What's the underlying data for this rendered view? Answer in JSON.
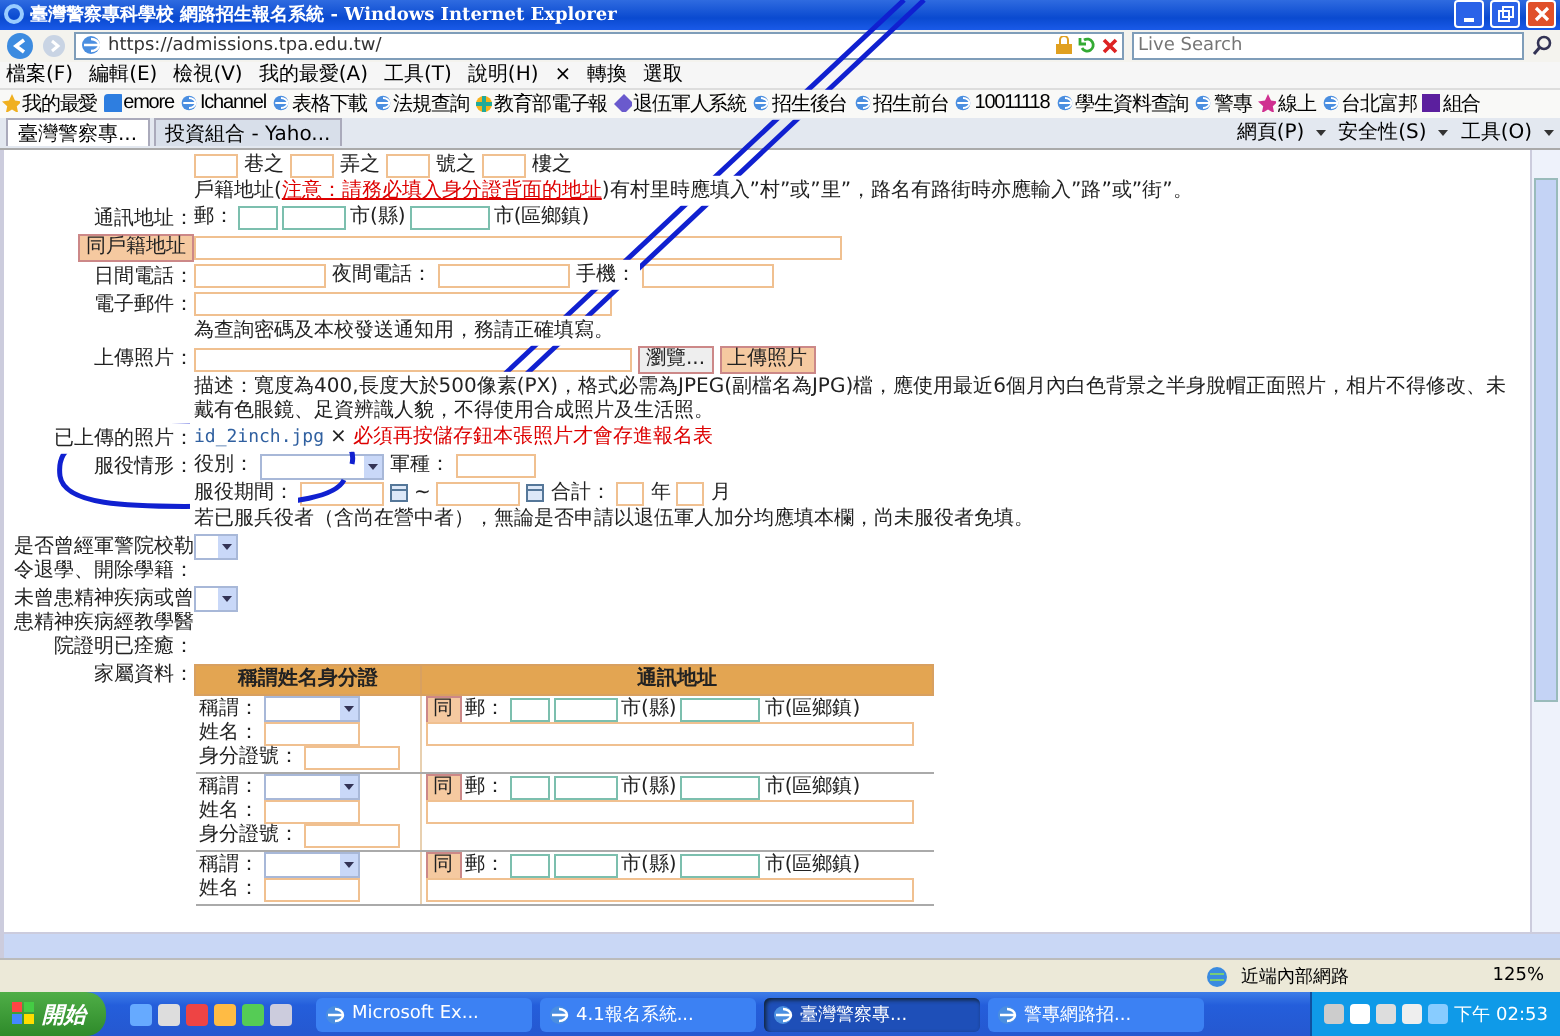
{
  "window": {
    "title": "臺灣警察專科學校 網路招生報名系統 - Windows Internet Explorer"
  },
  "address_bar": {
    "url": "https://admissions.tpa.edu.tw/",
    "search_placeholder": "Live Search"
  },
  "menu": [
    "檔案(F)",
    "編輯(E)",
    "檢視(V)",
    "我的最愛(A)",
    "工具(T)",
    "說明(H)"
  ],
  "menu_tools": {
    "close": "×",
    "items": [
      "轉換",
      "選取"
    ]
  },
  "favorites": {
    "label": "我的最愛",
    "links": [
      {
        "label": "emore",
        "kind": "square"
      },
      {
        "label": "Ichannel",
        "kind": "ie"
      },
      {
        "label": "表格下載",
        "kind": "ie"
      },
      {
        "label": "法規查詢",
        "kind": "ie"
      },
      {
        "label": "教育部電子報",
        "kind": "wheel"
      },
      {
        "label": "退伍軍人系統",
        "kind": "diamond"
      },
      {
        "label": "招生後台",
        "kind": "ie"
      },
      {
        "label": "招生前台",
        "kind": "ie"
      },
      {
        "label": "10011118",
        "kind": "ie"
      },
      {
        "label": "學生資料查詢",
        "kind": "ie"
      },
      {
        "label": "警專",
        "kind": "ie"
      },
      {
        "label": "線上",
        "kind": "star"
      },
      {
        "label": "台北富邦",
        "kind": "ie"
      },
      {
        "label": "組合",
        "kind": "yahoo"
      }
    ]
  },
  "tabs": [
    {
      "label": "臺灣警察專...",
      "selected": true
    },
    {
      "label": "投資組合 - Yaho...",
      "selected": false
    }
  ],
  "command_bar": [
    "網頁(P)",
    "安全性(S)",
    "工具(O)"
  ],
  "form": {
    "address_parts": [
      "巷之",
      "弄之",
      "號之",
      "樓之"
    ],
    "registered_address_note": {
      "prefix": "戶籍地址(",
      "warning": "注意：請務必填入身分證背面的地址",
      "suffix": ")有村里時應填入”村”或”里”，路名有路街時亦應輸入”路”或”街”。"
    },
    "mailing_address": {
      "label": "通訊地址：",
      "zip_label": "郵：",
      "county_suffix": "市(縣)",
      "district_suffix": "市(區鄉鎮)",
      "copy_button": "同戶籍地址"
    },
    "phones": [
      {
        "label": "日間電話："
      },
      {
        "label": "夜間電話："
      },
      {
        "label": "手機："
      }
    ],
    "email": {
      "label": "電子郵件：",
      "note": "為查詢密碼及本校發送通知用，務請正確填寫。"
    },
    "photo": {
      "label": "上傳照片：",
      "browse_button": "瀏覽...",
      "upload_button": "上傳照片",
      "description": "描述：寬度為400,長度大於500像素(PX)，格式必需為JPEG(副檔名為JPG)檔，應使用最近6個月內白色背景之半身脫帽正面照片，相片不得修改、未戴有色眼鏡、足資辨識人貌，不得使用合成照片及生活照。",
      "uploaded_label": "已上傳的照片：",
      "uploaded_file": "id_2inch.jpg",
      "remove": "×",
      "uploaded_warning": "必須再按儲存鈕本張照片才會存進報名表"
    },
    "military": {
      "label": "服役情形：",
      "type_label": "役別：",
      "branch_label": "軍種：",
      "period_label": "服役期間：",
      "range_sep": "~",
      "total_label": "合計：",
      "year_unit": "年",
      "month_unit": "月",
      "note": "若已服兵役者（含尚在營中者），無論是否申請以退伍軍人加分均應填本欄，尚未服役者免填。"
    },
    "questions": [
      {
        "label": "是否曾經軍警院校勒令退學、開除學籍："
      },
      {
        "label": "未曾患精神疾病或曾患精神疾病經教學醫院證明已痊癒："
      }
    ],
    "family": {
      "label": "家屬資料：",
      "columns": [
        "稱謂姓名身分證",
        "通訊地址"
      ],
      "rows": [
        {
          "title_label": "稱謂：",
          "name_label": "姓名：",
          "id_label": "身分證號：",
          "copy_button": "同",
          "zip_label": "郵：",
          "county_suffix": "市(縣)",
          "district_suffix": "市(區鄉鎮)"
        },
        {
          "title_label": "稱謂：",
          "name_label": "姓名：",
          "id_label": "身分證號：",
          "copy_button": "同",
          "zip_label": "郵：",
          "county_suffix": "市(縣)",
          "district_suffix": "市(區鄉鎮)"
        },
        {
          "title_label": "稱謂：",
          "name_label": "姓名：",
          "copy_button": "同",
          "zip_label": "郵：",
          "county_suffix": "市(縣)",
          "district_suffix": "市(區鄉鎮)"
        }
      ]
    }
  },
  "status_bar": {
    "zone": "近端內部網路",
    "zoom": "125%"
  },
  "taskbar": {
    "start": "開始",
    "tasks": [
      {
        "label": "Microsoft Ex...",
        "selected": false
      },
      {
        "label": "4.1報名系統...",
        "selected": false
      },
      {
        "label": "臺灣警察專...",
        "selected": true
      },
      {
        "label": "警專網路招...",
        "selected": false
      }
    ],
    "clock": "下午 02:53"
  }
}
